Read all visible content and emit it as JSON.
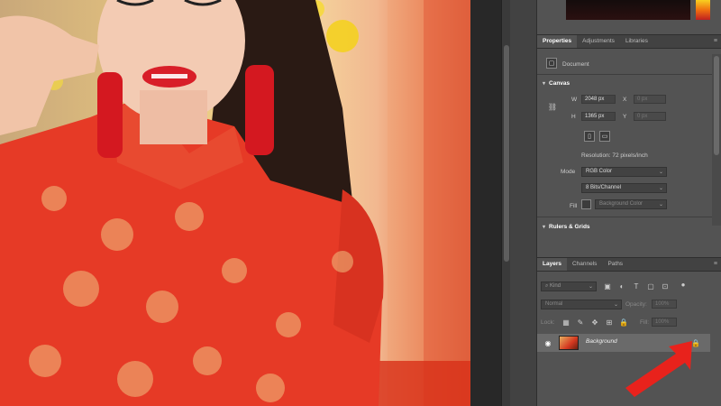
{
  "properties_panel": {
    "tabs": [
      {
        "label": "Properties",
        "active": true
      },
      {
        "label": "Adjustments",
        "active": false
      },
      {
        "label": "Libraries",
        "active": false
      }
    ],
    "document_label": "Document",
    "canvas_section": "Canvas",
    "width_label": "W",
    "width_value": "2048 px",
    "x_label": "X",
    "x_value": "0 px",
    "height_label": "H",
    "height_value": "1365 px",
    "y_label": "Y",
    "y_value": "0 px",
    "resolution": "Resolution: 72 pixels/inch",
    "mode_label": "Mode",
    "mode_value": "RGB Color",
    "bits_value": "8 Bits/Channel",
    "fill_label": "Fill",
    "fill_value": "Background Color",
    "rulers_section": "Rulers & Grids"
  },
  "layers_panel": {
    "tabs": [
      {
        "label": "Layers",
        "active": true
      },
      {
        "label": "Channels",
        "active": false
      },
      {
        "label": "Paths",
        "active": false
      }
    ],
    "filter_placeholder": "Kind",
    "blend_mode": "Normal",
    "opacity_label": "Opacity:",
    "opacity_value": "100%",
    "lock_label": "Lock:",
    "fill_label": "Fill:",
    "fill_value": "100%",
    "layers": [
      {
        "name": "Background",
        "visible": true,
        "locked": true
      }
    ]
  },
  "colors": {
    "panel_bg": "#535353",
    "dark_bg": "#282828",
    "arrow": "#e8221c"
  },
  "icons": [
    "eye-icon",
    "lock-icon",
    "link-icon",
    "menu-icon",
    "chevron-down-icon"
  ]
}
